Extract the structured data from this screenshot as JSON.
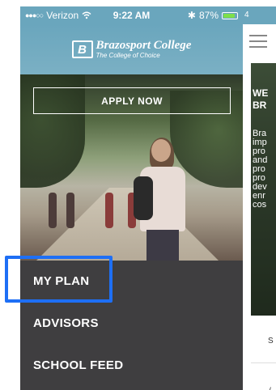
{
  "status_bar": {
    "signal": "●●●○○",
    "carrier": "Verizon",
    "wifi": "wifi",
    "time": "9:22 AM",
    "bluetooth": "✱",
    "battery_percent": "87%",
    "battery_level": 0.87
  },
  "header": {
    "logo_mark": "B",
    "college_name": "Brazosport College",
    "tagline": "The College of Choice"
  },
  "hero": {
    "apply_label": "APPLY NOW"
  },
  "menu": {
    "items": [
      {
        "label": "MY PLAN"
      },
      {
        "label": "ADVISORS"
      },
      {
        "label": "SCHOOL FEED"
      }
    ]
  },
  "background_page": {
    "status_fragment": "4",
    "hero_heading": [
      "WE",
      "BR"
    ],
    "hero_lines": [
      "Bra",
      "imp",
      "pro",
      "and",
      "pro",
      "pro",
      "dev",
      "enr",
      "cos"
    ],
    "footer_text": "S",
    "bottom_text": "/"
  },
  "colors": {
    "header_blue": "#6aa6bd",
    "drawer_bg": "#3f3e40",
    "highlight_blue": "#1e6ff5"
  }
}
